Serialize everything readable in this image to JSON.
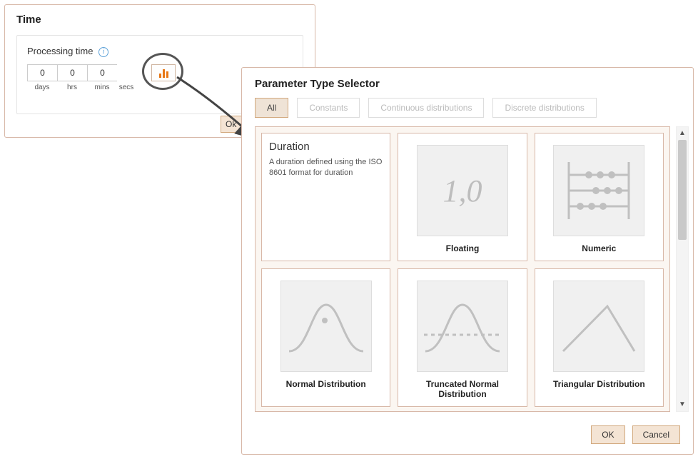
{
  "time_panel": {
    "title": "Time",
    "processing_label": "Processing time",
    "fields": {
      "days_value": "0",
      "days_unit": "days",
      "hrs_value": "0",
      "hrs_unit": "hrs",
      "mins_value": "0",
      "mins_unit": "mins",
      "secs_value": "",
      "secs_unit": "secs"
    },
    "ok_label": "Ok"
  },
  "selector": {
    "title": "Parameter Type Selector",
    "tabs": {
      "all": "All",
      "constants": "Constants",
      "continuous": "Continuous distributions",
      "discrete": "Discrete distributions"
    },
    "cards": {
      "duration_title": "Duration",
      "duration_desc": "A duration defined using the ISO 8601 format for duration",
      "floating": "Floating",
      "floating_sample": "1,0",
      "numeric": "Numeric",
      "normal": "Normal Distribution",
      "truncated": "Truncated Normal Distribution",
      "triangular": "Triangular Distribution"
    },
    "buttons": {
      "ok": "OK",
      "cancel": "Cancel"
    }
  }
}
